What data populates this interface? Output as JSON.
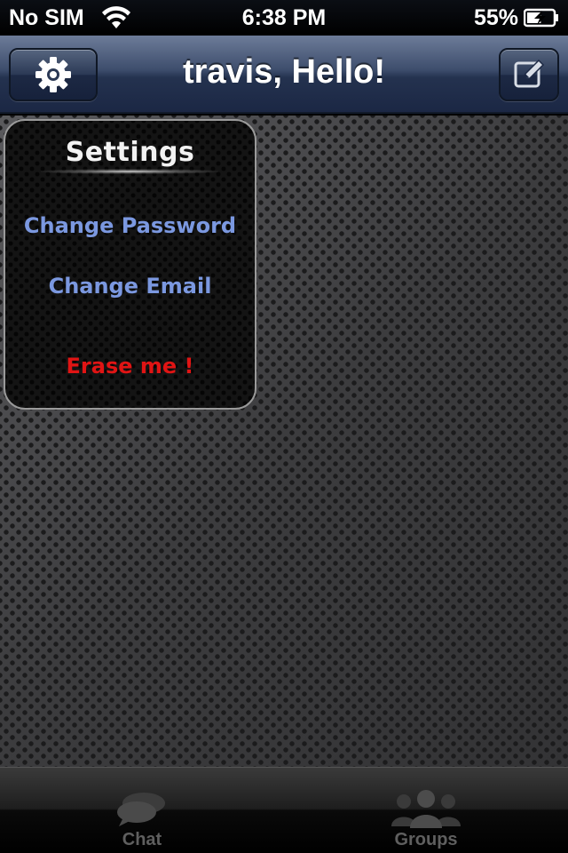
{
  "status_bar": {
    "carrier": "No SIM",
    "time": "6:38 PM",
    "battery_percent": "55%",
    "battery_level": 0.55
  },
  "nav_bar": {
    "title": "travis, Hello!",
    "left_icon": "gear-icon",
    "right_icon": "compose-icon"
  },
  "settings": {
    "title": "Settings",
    "items": [
      {
        "label": "Change Password",
        "color": "#7b98e0"
      },
      {
        "label": "Change Email",
        "color": "#7b98e0"
      },
      {
        "label": "Erase me !",
        "color": "#e01414"
      }
    ]
  },
  "tab_bar": {
    "tabs": [
      {
        "label": "Chat",
        "icon": "chat-bubble-icon"
      },
      {
        "label": "Groups",
        "icon": "groups-icon"
      }
    ]
  }
}
